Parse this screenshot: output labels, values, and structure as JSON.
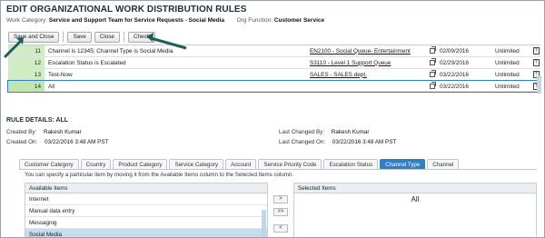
{
  "page": {
    "title": "EDIT ORGANIZATIONAL WORK DISTRIBUTION RULES",
    "work_category_label": "Work Category:",
    "work_category_value": "Service and Support Team for Service Requests - Social Media",
    "org_function_label": "Org Function:",
    "org_function_value": "Customer Service"
  },
  "toolbar": {
    "save_close": "Save and Close",
    "save": "Save",
    "close": "Close",
    "check": "Check"
  },
  "grid": {
    "rows": [
      {
        "num": "11",
        "name": "Channel is 12345; Channel Type is Social Media",
        "dept": "EN2100 - Social Queue- Entertainment",
        "date": "02/09/2016",
        "limit": "Unlimited"
      },
      {
        "num": "12",
        "name": "Escalation Status is Escalated",
        "dept": "S3110 - Level 1 Support Queue",
        "date": "02/29/2016",
        "limit": "Unlimited"
      },
      {
        "num": "13",
        "name": "Test-Now",
        "dept": "SALES - SALES dept.",
        "date": "03/22/2016",
        "limit": "Unlimited"
      },
      {
        "num": "14",
        "name": "All",
        "dept": "",
        "date": "03/22/2016",
        "limit": "Unlimited"
      }
    ]
  },
  "rule_details": {
    "heading": "RULE DETAILS: ALL",
    "created_by_label": "Created By:",
    "created_by": "Rakesh Kumar",
    "created_on_label": "Created On:",
    "created_on": "03/22/2016 3:48 AM PST",
    "changed_by_label": "Last Changed By:",
    "changed_by": "Rakesh Kumar",
    "changed_on_label": "Last Changed On:",
    "changed_on": "03/22/2016 3:48 AM PST"
  },
  "tabs": [
    "Customer Category",
    "Country",
    "Product Category",
    "Service Category",
    "Account",
    "Service Priority Code",
    "Escalation Status",
    "Channel Type",
    "Channel"
  ],
  "active_tab": "Channel Type",
  "hint": "You can specify a particular item by moving it from the Available Items column to the Selected Items column.",
  "available": {
    "header": "Available Items",
    "items": [
      "Internet",
      "Manual data entry",
      "Messaging",
      "Social Media"
    ]
  },
  "selected": {
    "header": "Selected Items",
    "items": [
      "All"
    ]
  },
  "move_buttons": [
    ">",
    ">>",
    "<"
  ],
  "colors": {
    "accent": "#2f7fc1",
    "row_number_bg": "#cfecc5",
    "arrow": "#1f5f5a"
  }
}
